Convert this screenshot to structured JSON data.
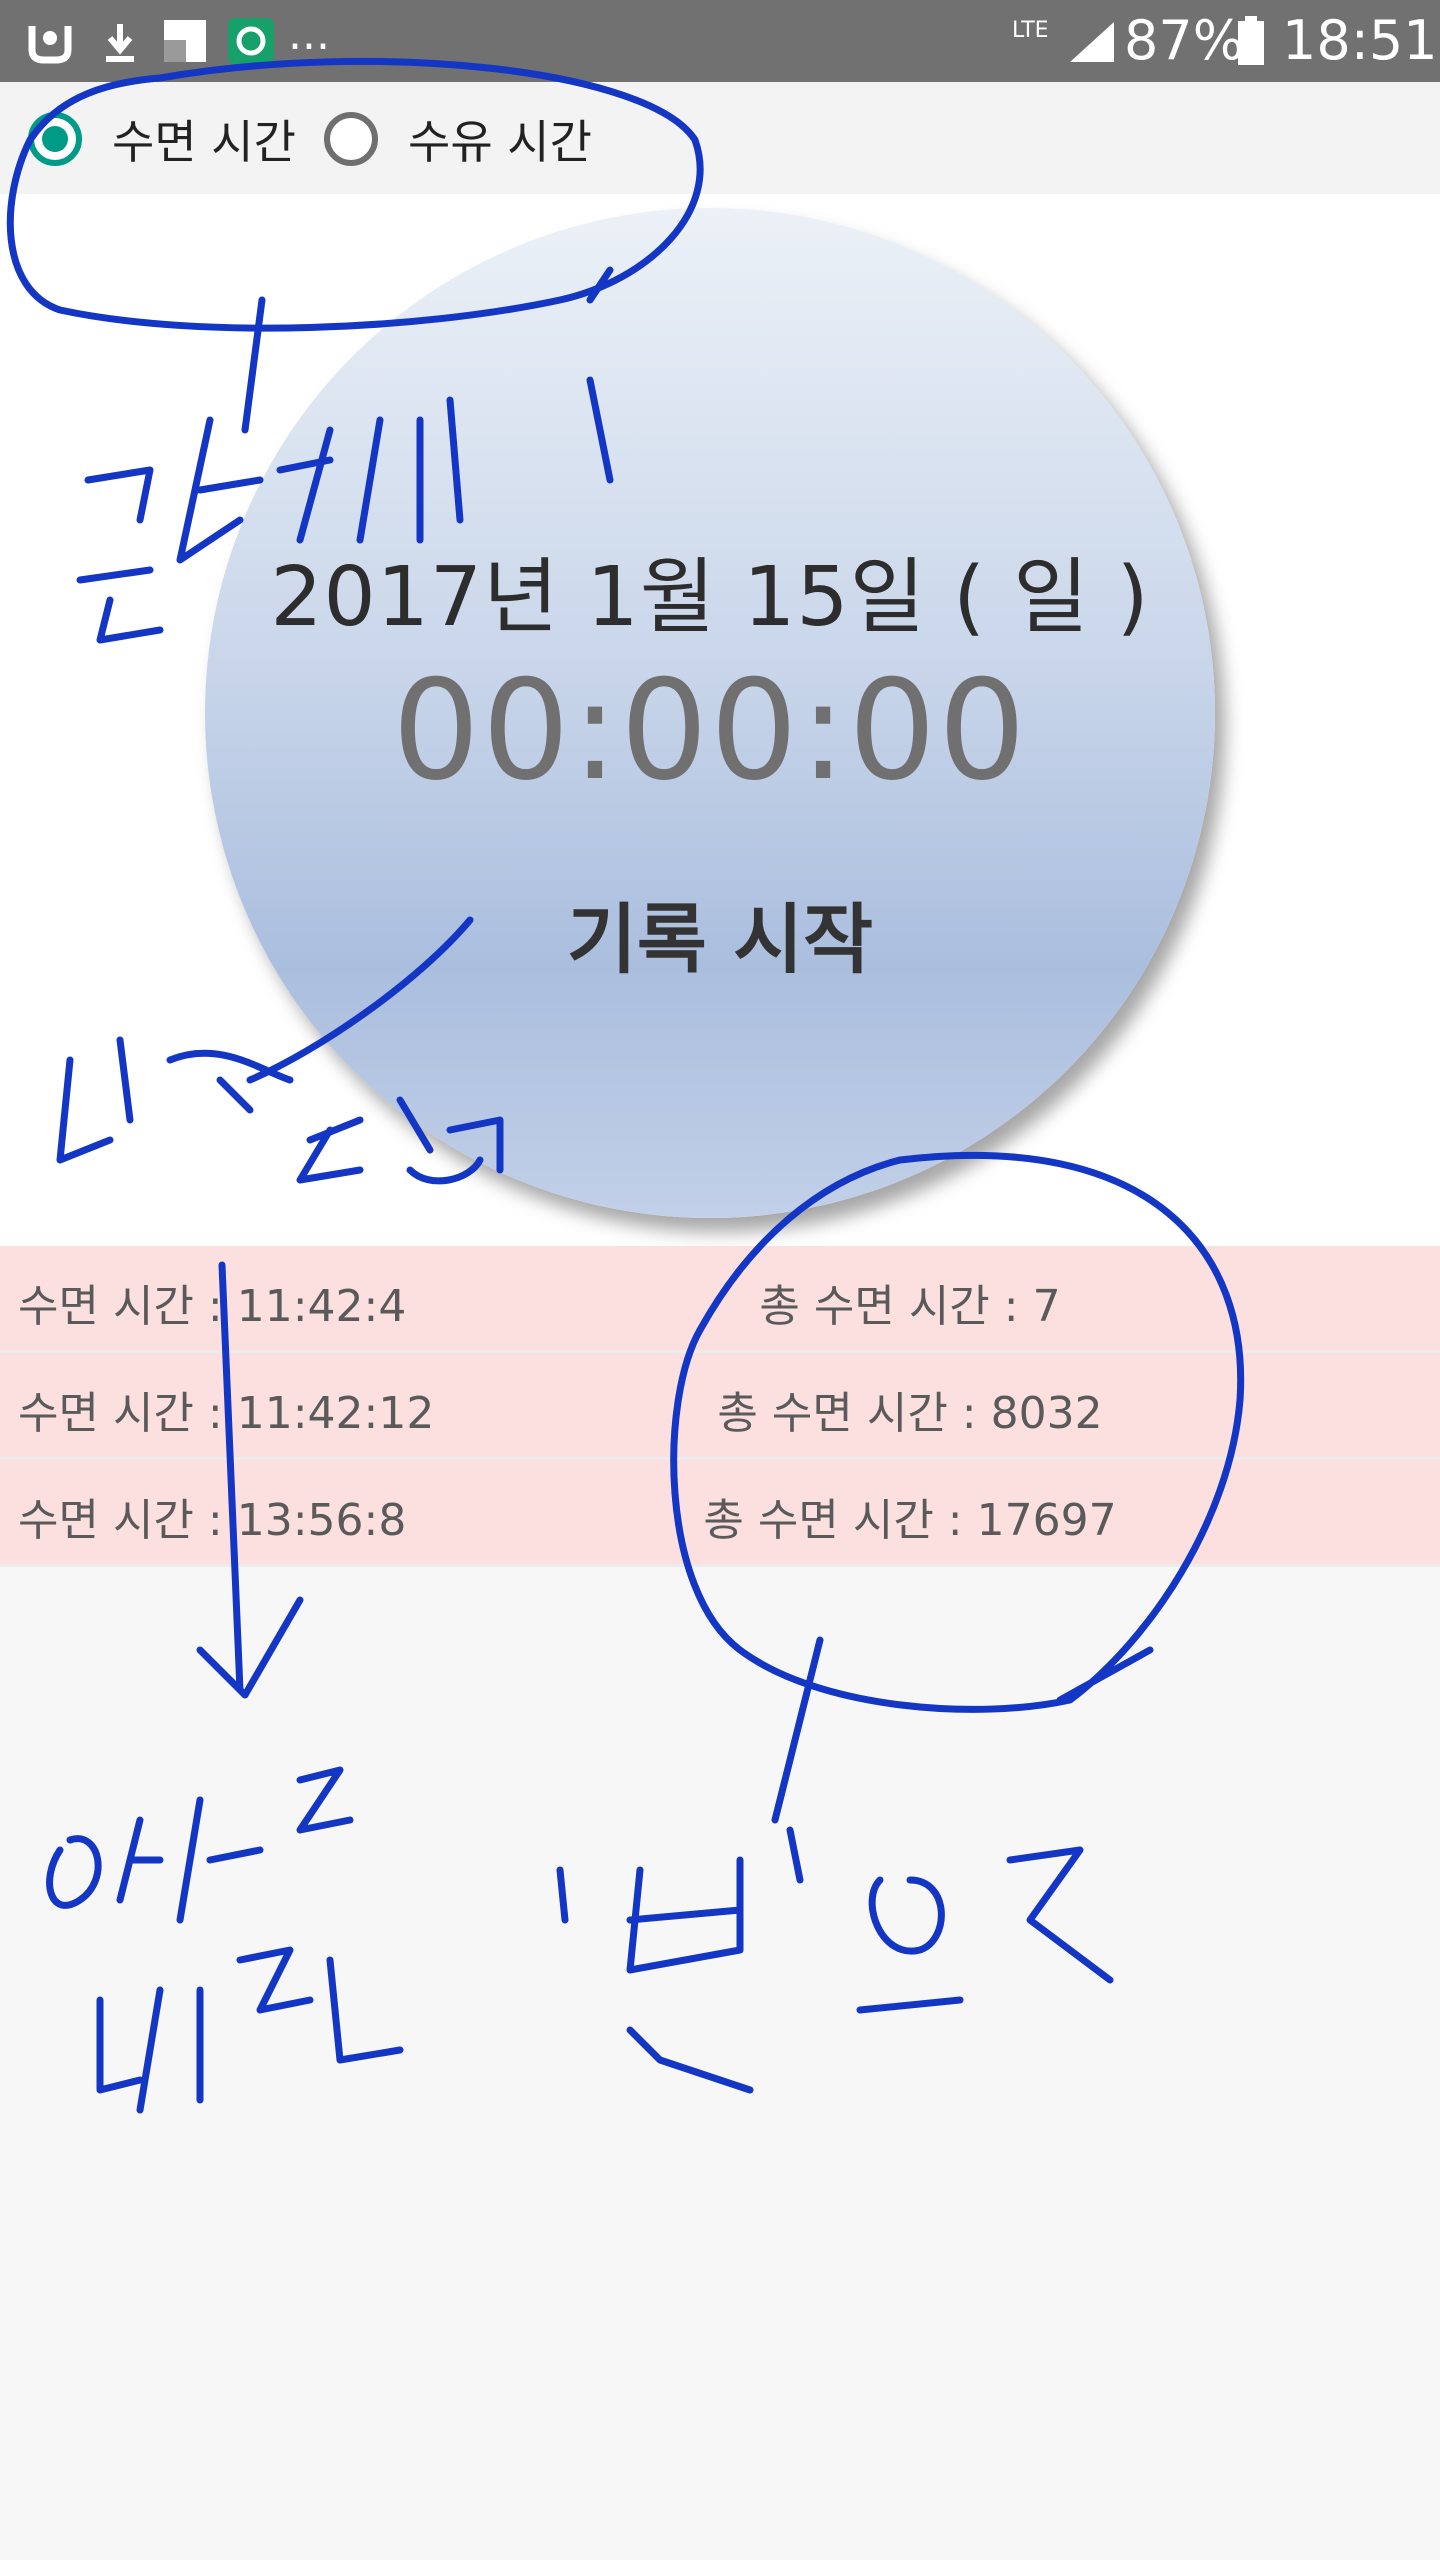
{
  "status_bar": {
    "network": "LTE",
    "battery": "87%",
    "time": "18:51",
    "more": "..."
  },
  "mode_selector": {
    "options": [
      {
        "label": "수면 시간",
        "checked": true
      },
      {
        "label": "수유 시간",
        "checked": false
      }
    ]
  },
  "timer": {
    "date": "2017년 1월 15일 ( 일 )",
    "elapsed": "00:00:00",
    "start_label": "기록 시작"
  },
  "records": [
    {
      "time": "수면 시간 : 11:42:4",
      "total": "총 수면 시간 : 7"
    },
    {
      "time": "수면 시간 : 11:42:12",
      "total": "총 수면 시간 : 8032"
    },
    {
      "time": "수면 시간 : 13:56:8",
      "total": "총 수면 시간 : 17697"
    }
  ],
  "handwritten_notes": [
    "글자크기",
    "디자인 좋음",
    "아래로 내려감",
    "'분'으로"
  ],
  "colors": {
    "status_bar": "#717171",
    "radio_accent": "#009b86",
    "record_row": "#fcdfdf",
    "ink": "#1436c4"
  }
}
